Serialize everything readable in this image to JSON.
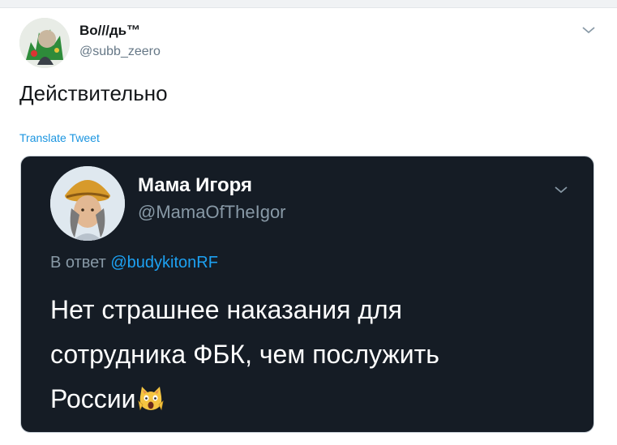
{
  "author": {
    "name": "Во///дь™",
    "handle": "@subb_zeero"
  },
  "tweet": {
    "text": "Действительно",
    "translate_label": "Translate Tweet"
  },
  "quoted": {
    "name": "Мама Игоря",
    "handle": "@MamaOfTheIgor",
    "reply_prefix": "В ответ",
    "reply_mention": "@budykitonRF",
    "line1": "Нет страшнее наказания для",
    "line2": "сотрудника ФБК, чем послужить",
    "line3": "России"
  },
  "icons": {
    "menu": "chevron-down-icon",
    "emoji": "scream-cat-emoji"
  },
  "colors": {
    "link": "#1b95e0",
    "mention": "#1da1f2",
    "dark_card": "#151c25",
    "secondary_text": "#657786"
  }
}
